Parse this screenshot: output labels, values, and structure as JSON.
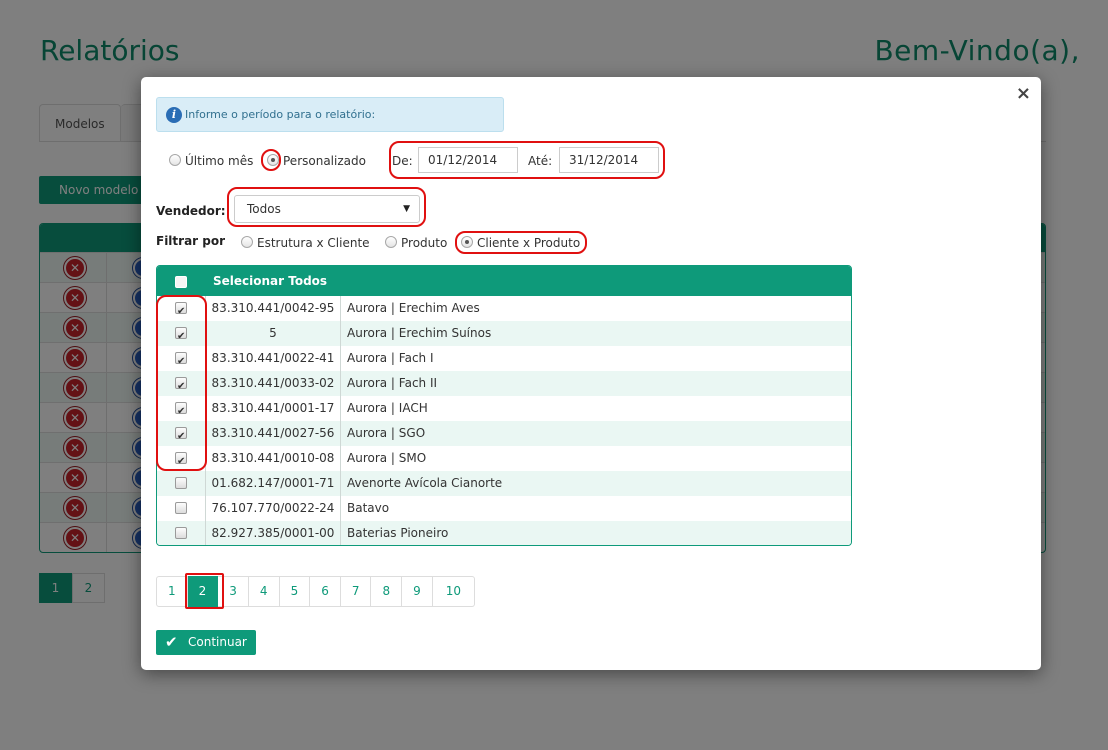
{
  "background": {
    "title": "Relatórios",
    "welcome": "Bem-Vindo(a),",
    "tab_label": "Modelos",
    "new_model_label": "Novo modelo",
    "pages": [
      "1",
      "2"
    ]
  },
  "modal": {
    "close_glyph": "×",
    "info_icon": "i",
    "info_text": "Informe o período para o relatório:",
    "period": {
      "options": [
        "Último mês",
        "Personalizado"
      ],
      "selected": "Personalizado",
      "from_label": "De:",
      "from_value": "01/12/2014",
      "to_label": "Até:",
      "to_value": "31/12/2014"
    },
    "vendor": {
      "label": "Vendedor:",
      "selected": "Todos",
      "arrow": "▼"
    },
    "filter": {
      "label": "Filtrar por",
      "options": [
        "Estrutura x Cliente",
        "Produto",
        "Cliente x Produto"
      ],
      "selected": "Cliente x Produto"
    },
    "table": {
      "select_all_label": "Selecionar Todos",
      "rows": [
        {
          "code": "83.310.441/0042-95",
          "name": "Aurora | Erechim Aves",
          "checked": true
        },
        {
          "code": "5",
          "name": "Aurora | Erechim Suínos",
          "checked": true
        },
        {
          "code": "83.310.441/0022-41",
          "name": "Aurora | Fach I",
          "checked": true
        },
        {
          "code": "83.310.441/0033-02",
          "name": "Aurora | Fach II",
          "checked": true
        },
        {
          "code": "83.310.441/0001-17",
          "name": "Aurora | IACH",
          "checked": true
        },
        {
          "code": "83.310.441/0027-56",
          "name": "Aurora | SGO",
          "checked": true
        },
        {
          "code": "83.310.441/0010-08",
          "name": "Aurora | SMO",
          "checked": true
        },
        {
          "code": "01.682.147/0001-71",
          "name": "Avenorte Avícola Cianorte",
          "checked": false
        },
        {
          "code": "76.107.770/0022-24",
          "name": "Batavo",
          "checked": false
        },
        {
          "code": "82.927.385/0001-00",
          "name": "Baterias Pioneiro",
          "checked": false
        }
      ]
    },
    "pagination": {
      "pages": [
        "1",
        "2",
        "3",
        "4",
        "5",
        "6",
        "7",
        "8",
        "9",
        "10"
      ],
      "active": "2"
    },
    "continue_label": "Continuar",
    "continue_icon": "✔"
  },
  "colors": {
    "accent": "#0e9a7a",
    "highlight": "#e01010",
    "info_bg": "#d9edf7"
  }
}
